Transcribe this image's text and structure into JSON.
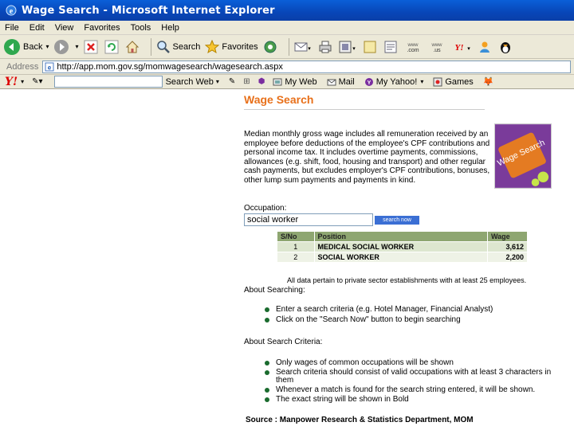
{
  "window": {
    "title": "Wage Search - Microsoft Internet Explorer"
  },
  "menu": [
    "File",
    "Edit",
    "View",
    "Favorites",
    "Tools",
    "Help"
  ],
  "toolbar": {
    "back_label": "Back",
    "search_label": "Search",
    "favorites_label": "Favorites"
  },
  "address": {
    "label": "Address",
    "url": "http://app.mom.gov.sg/momwagesearch/wagesearch.aspx"
  },
  "yahoo_toolbar": {
    "search_web_label": "Search Web",
    "my_web_label": "My Web",
    "mail_label": "Mail",
    "my_yahoo_label": "My Yahoo!",
    "games_label": "Games"
  },
  "page": {
    "title": "Wage Search",
    "intro": "Median monthly gross wage includes all remuneration received by an employee before deductions of the employee's CPF contributions and personal income tax. It includes overtime payments, commissions, allowances (e.g. shift, food, housing and transport) and other regular cash payments, but excludes employer's CPF contributions, bonuses, other lump sum payments and payments in kind.",
    "logo_text": "Wage Search",
    "occupation_label": "Occupation:",
    "occupation_value": "social worker",
    "search_button_label": "search now",
    "table": {
      "headers": [
        "S/No",
        "Position",
        "Wage"
      ],
      "rows": [
        {
          "sno": "1",
          "position": "MEDICAL SOCIAL WORKER",
          "wage": "3,612"
        },
        {
          "sno": "2",
          "position": "SOCIAL WORKER",
          "wage": "2,200"
        }
      ]
    },
    "note": "All data pertain to private sector establishments with at least 25 employees.",
    "about_searching": {
      "heading": "About Searching:",
      "items": [
        "Enter a search criteria (e.g. Hotel Manager, Financial Analyst)",
        "Click on the \"Search Now\" button to begin searching"
      ]
    },
    "about_criteria": {
      "heading": "About Search Criteria:",
      "items": [
        "Only wages of common occupations will be shown",
        "Search criteria should consist of valid occupations with at least 3 characters in them",
        "Whenever a match is found for the search string entered, it will be shown.",
        "The exact string will be shown in Bold"
      ]
    },
    "source": "Source : Manpower Research & Statistics Department, MOM"
  }
}
